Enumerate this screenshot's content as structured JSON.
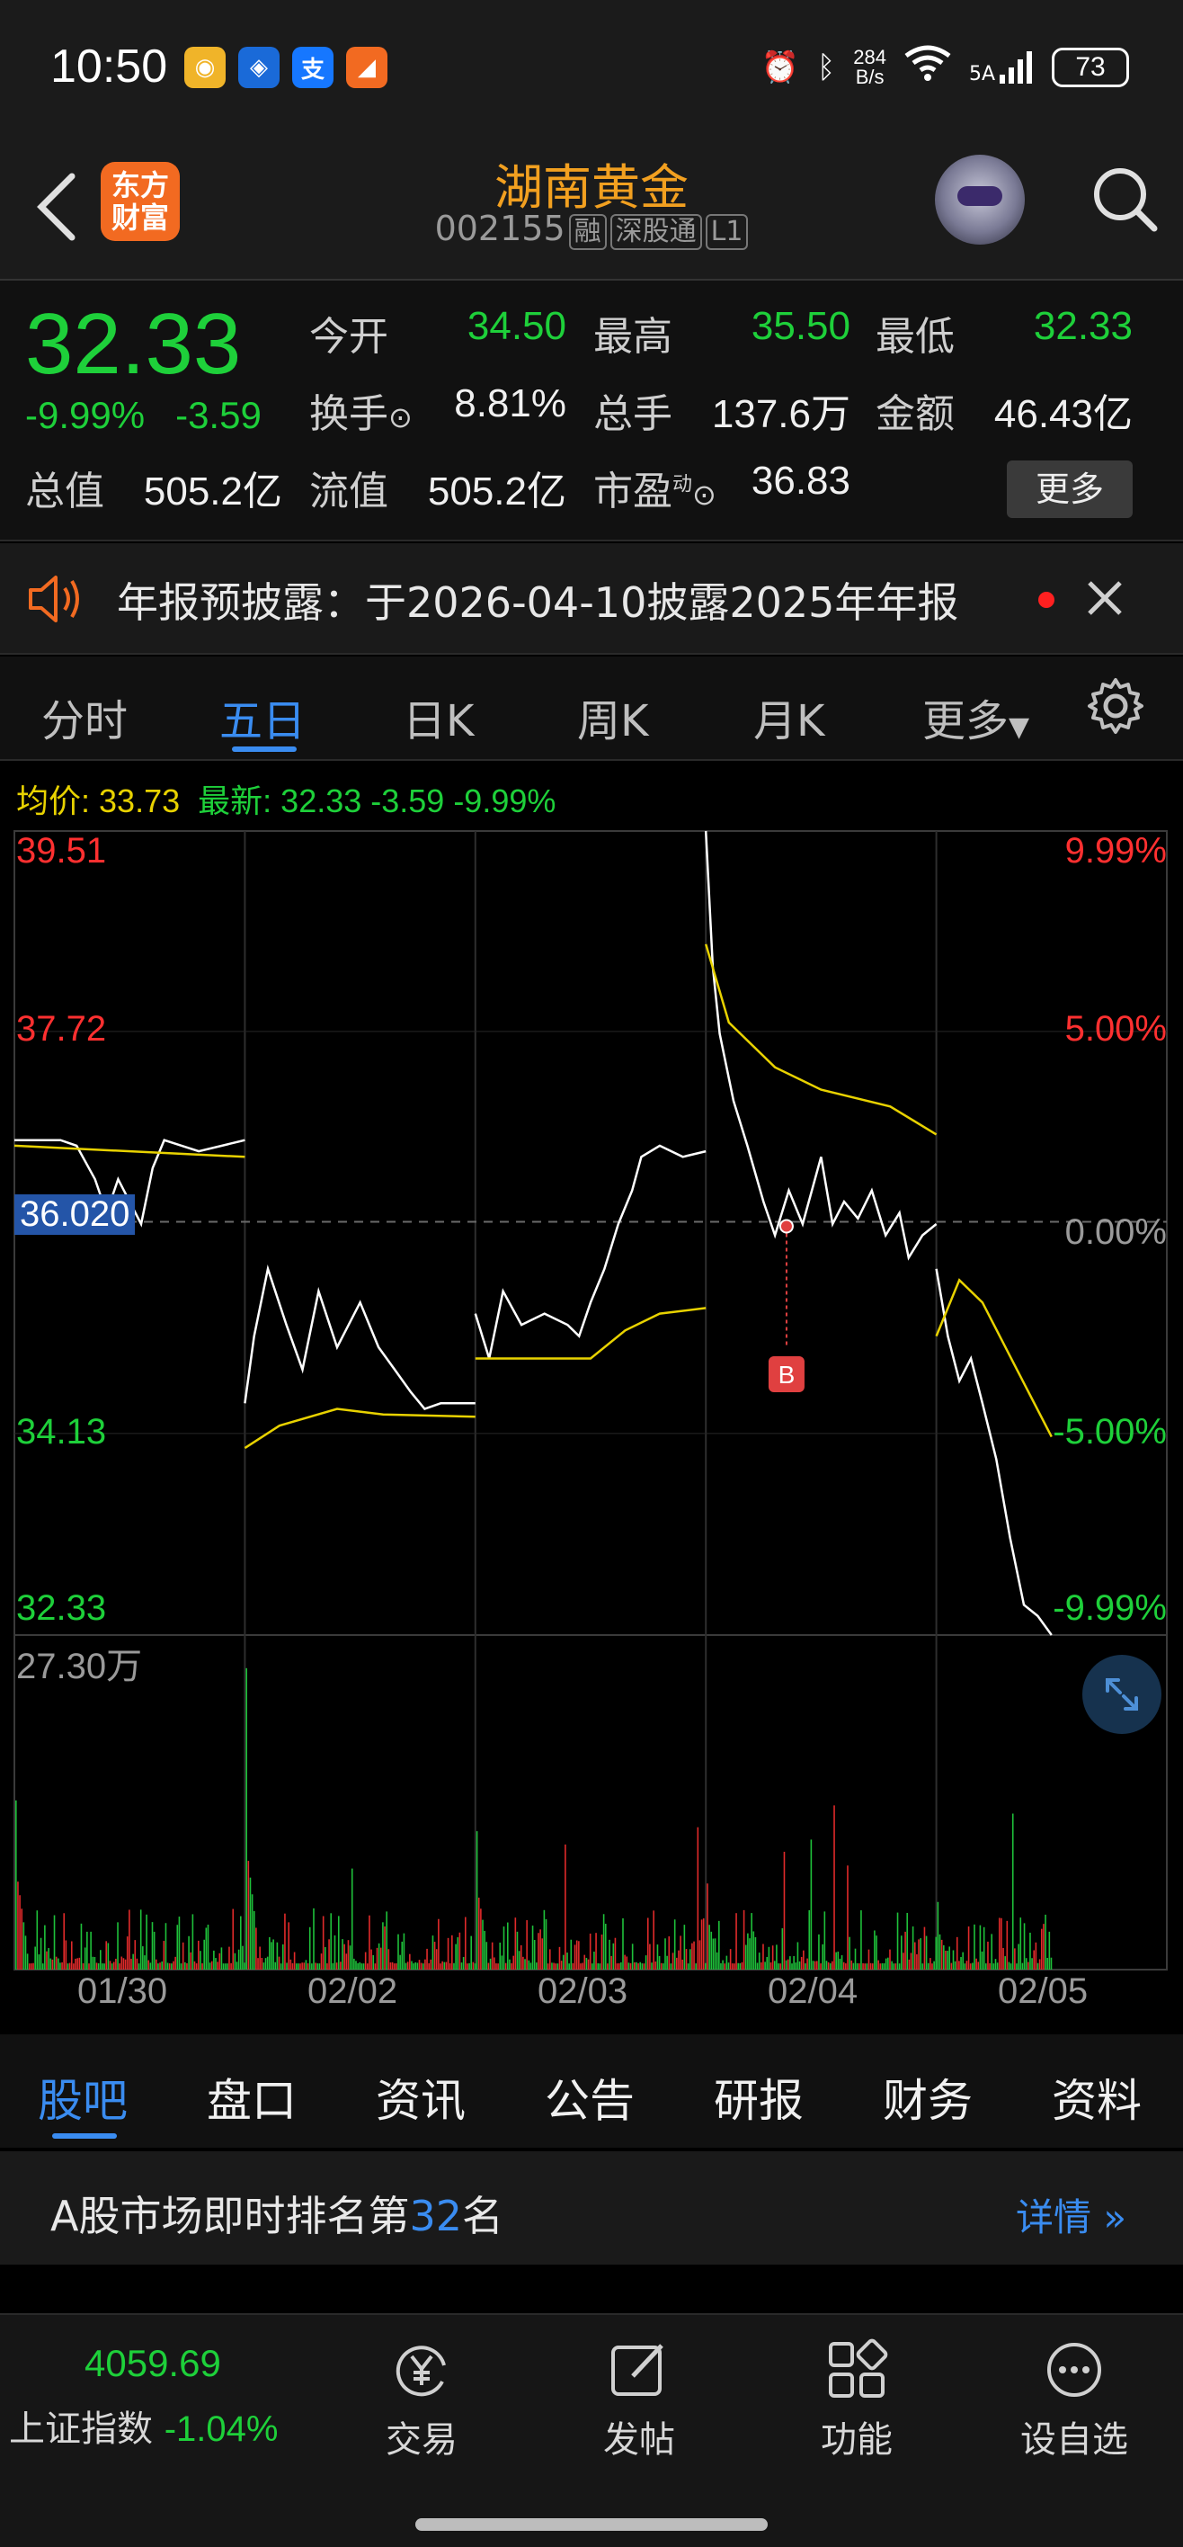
{
  "status_bar": {
    "time": "10:50",
    "net_speed_value": "284",
    "net_speed_unit": "B/s",
    "signal_label": "5A",
    "battery": "73"
  },
  "header": {
    "stock_name": "湖南黄金",
    "stock_code": "002155",
    "tags": [
      "融",
      "深股通",
      "L1"
    ],
    "logo_text_1": "东方",
    "logo_text_2": "财富"
  },
  "quote": {
    "price": "32.33",
    "change_pct": "-9.99%",
    "change_abs": "-3.59",
    "open_label": "今开",
    "open": "34.50",
    "high_label": "最高",
    "high": "35.50",
    "low_label": "最低",
    "low": "32.33",
    "turnover_label": "换手",
    "turnover": "8.81%",
    "volume_label": "总手",
    "volume": "137.6万",
    "amount_label": "金额",
    "amount": "46.43亿",
    "mktcap_label": "总值",
    "mktcap": "505.2亿",
    "float_label": "流值",
    "float_cap": "505.2亿",
    "pe_label": "市盈",
    "pe_sup": "动",
    "pe": "36.83",
    "more_button": "更多"
  },
  "notice": {
    "text": "年报预披露：于2026-04-10披露2025年年报"
  },
  "chart_tabs": [
    "分时",
    "五日",
    "日K",
    "周K",
    "月K",
    "更多"
  ],
  "info_line": {
    "avg_label": "均价:",
    "avg_value": "33.73",
    "latest_label": "最新:",
    "latest_value": "32.33 -3.59 -9.99%"
  },
  "chart_data": {
    "type": "line",
    "title": "",
    "y_left_ticks": [
      "39.51",
      "37.72",
      "36.020",
      "34.13",
      "32.33"
    ],
    "y_right_ticks": [
      "9.99%",
      "5.00%",
      "0.00%",
      "-5.00%",
      "-9.99%"
    ],
    "ylim": [
      32.33,
      39.51
    ],
    "prev_close": 36.02,
    "volume_max_label": "27.30万",
    "x_dates": [
      "01/30",
      "02/02",
      "02/03",
      "02/04",
      "02/05"
    ],
    "marker_label": "B",
    "series": [
      {
        "name": "最新",
        "days": [
          [
            [
              0,
              36.75
            ],
            [
              0.2,
              36.75
            ],
            [
              0.27,
              36.7
            ],
            [
              0.35,
              36.4
            ],
            [
              0.4,
              36.1
            ],
            [
              0.45,
              36.4
            ],
            [
              0.5,
              36.2
            ],
            [
              0.55,
              36.0
            ],
            [
              0.6,
              36.5
            ],
            [
              0.65,
              36.75
            ],
            [
              0.8,
              36.65
            ],
            [
              1,
              36.75
            ]
          ],
          [
            [
              0,
              34.4
            ],
            [
              0.04,
              35.0
            ],
            [
              0.1,
              35.6
            ],
            [
              0.18,
              35.1
            ],
            [
              0.25,
              34.7
            ],
            [
              0.32,
              35.4
            ],
            [
              0.4,
              34.9
            ],
            [
              0.5,
              35.3
            ],
            [
              0.58,
              34.9
            ],
            [
              0.65,
              34.7
            ],
            [
              0.72,
              34.5
            ],
            [
              0.78,
              34.35
            ],
            [
              0.85,
              34.4
            ],
            [
              1,
              34.4
            ]
          ],
          [
            [
              0,
              35.2
            ],
            [
              0.06,
              34.8
            ],
            [
              0.12,
              35.4
            ],
            [
              0.2,
              35.1
            ],
            [
              0.3,
              35.2
            ],
            [
              0.4,
              35.1
            ],
            [
              0.45,
              35.0
            ],
            [
              0.5,
              35.3
            ],
            [
              0.56,
              35.6
            ],
            [
              0.62,
              36.0
            ],
            [
              0.68,
              36.3
            ],
            [
              0.72,
              36.6
            ],
            [
              0.8,
              36.7
            ],
            [
              0.9,
              36.6
            ],
            [
              1,
              36.65
            ]
          ],
          [
            [
              0,
              39.51
            ],
            [
              0.03,
              38.3
            ],
            [
              0.06,
              37.7
            ],
            [
              0.12,
              37.1
            ],
            [
              0.18,
              36.7
            ],
            [
              0.25,
              36.2
            ],
            [
              0.3,
              35.9
            ],
            [
              0.36,
              36.3
            ],
            [
              0.42,
              36.0
            ],
            [
              0.5,
              36.6
            ],
            [
              0.55,
              36.0
            ],
            [
              0.6,
              36.2
            ],
            [
              0.66,
              36.05
            ],
            [
              0.72,
              36.3
            ],
            [
              0.78,
              35.9
            ],
            [
              0.84,
              36.1
            ],
            [
              0.88,
              35.7
            ],
            [
              0.94,
              35.9
            ],
            [
              1,
              36.0
            ]
          ],
          [
            [
              0,
              35.6
            ],
            [
              0.05,
              35.0
            ],
            [
              0.1,
              34.6
            ],
            [
              0.15,
              34.8
            ],
            [
              0.2,
              34.4
            ],
            [
              0.26,
              33.9
            ],
            [
              0.32,
              33.2
            ],
            [
              0.38,
              32.6
            ],
            [
              0.44,
              32.5
            ],
            [
              0.5,
              32.33
            ]
          ]
        ]
      },
      {
        "name": "均价",
        "days": [
          [
            [
              0,
              36.7
            ],
            [
              1,
              36.6
            ]
          ],
          [
            [
              0,
              34.0
            ],
            [
              0.15,
              34.2
            ],
            [
              0.4,
              34.35
            ],
            [
              0.6,
              34.3
            ],
            [
              1,
              34.28
            ]
          ],
          [
            [
              0,
              34.8
            ],
            [
              0.5,
              34.8
            ],
            [
              0.65,
              35.05
            ],
            [
              0.8,
              35.2
            ],
            [
              1,
              35.25
            ]
          ],
          [
            [
              0,
              38.5
            ],
            [
              0.1,
              37.8
            ],
            [
              0.3,
              37.4
            ],
            [
              0.5,
              37.2
            ],
            [
              0.8,
              37.05
            ],
            [
              1,
              36.8
            ]
          ],
          [
            [
              0,
              35.0
            ],
            [
              0.1,
              35.5
            ],
            [
              0.2,
              35.3
            ],
            [
              0.35,
              34.7
            ],
            [
              0.5,
              34.1
            ]
          ]
        ]
      }
    ]
  },
  "lower_tabs": [
    "股吧",
    "盘口",
    "资讯",
    "公告",
    "研报",
    "财务",
    "资料"
  ],
  "rank": {
    "prefix": "A股市场即时排名第",
    "number": "32",
    "suffix": "名",
    "link": "详情"
  },
  "bottom_nav": {
    "index_value": "4059.69",
    "index_name": "上证指数",
    "index_change": "-1.04%",
    "items": [
      "交易",
      "发帖",
      "功能",
      "设自选"
    ]
  },
  "colors": {
    "up": "#ff3030",
    "down": "#1ed03a",
    "accent": "#3a8cf0",
    "avg_line": "#e8d200",
    "title": "#f2a020"
  }
}
